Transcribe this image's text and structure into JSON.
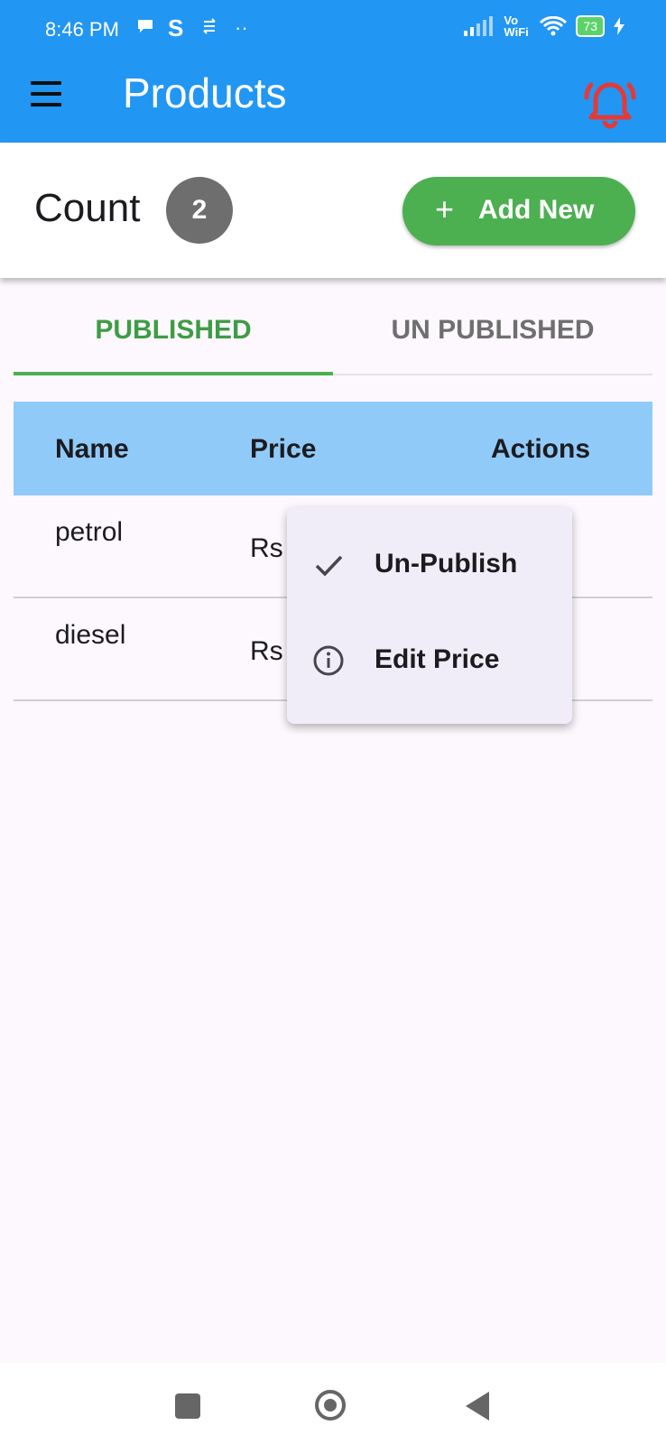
{
  "status_bar": {
    "time": "8:46 PM",
    "notifications": [
      "chat-bubble-icon",
      "s-icon",
      "sync-icon",
      "more-dots-icon"
    ],
    "network_label": "Vo WiFi",
    "battery": "73"
  },
  "app_bar": {
    "title": "Products",
    "menu_icon": "hamburger-icon",
    "alert_icon": "bell-alert-icon",
    "alert_color": "#e53935",
    "background": "#2196f3"
  },
  "header": {
    "count_label": "Count",
    "count_value": "2",
    "add_button_label": "Add New",
    "add_button_color": "#4caf50"
  },
  "tabs": [
    {
      "label": "PUBLISHED",
      "active": true
    },
    {
      "label": "UN PUBLISHED",
      "active": false
    }
  ],
  "table": {
    "columns": [
      "Name",
      "Price",
      "Actions"
    ],
    "rows": [
      {
        "name": "petrol",
        "price": "Rs"
      },
      {
        "name": "diesel",
        "price": "Rs"
      }
    ]
  },
  "popup_menu": {
    "items": [
      {
        "label": "Un-Publish",
        "icon": "check-icon"
      },
      {
        "label": "Edit Price",
        "icon": "info-icon"
      }
    ]
  },
  "nav_bar": {
    "buttons": [
      "recents-square-icon",
      "home-circle-icon",
      "back-triangle-icon"
    ]
  }
}
